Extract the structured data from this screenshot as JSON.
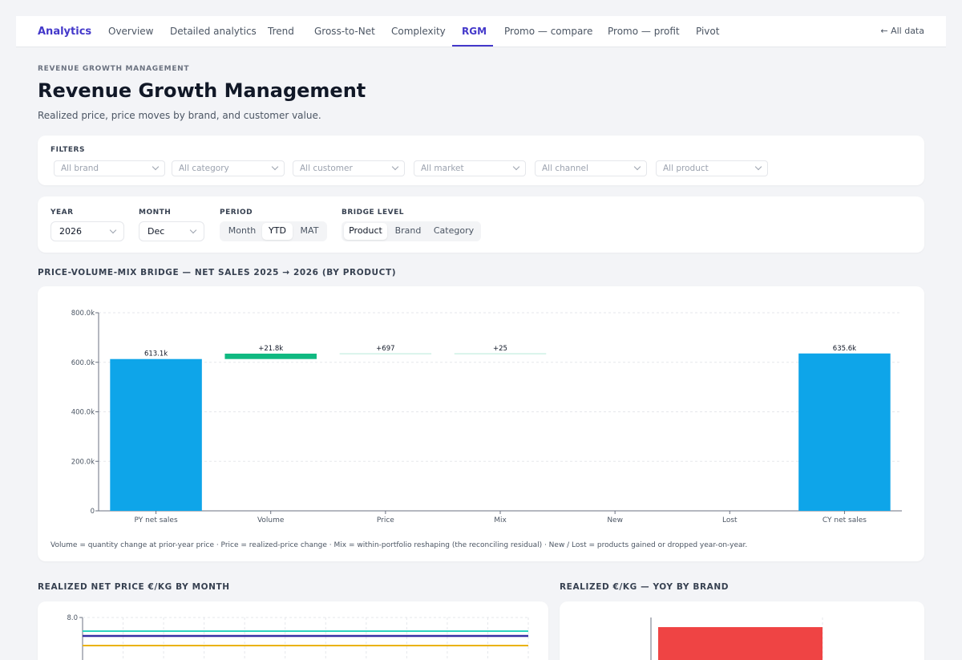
{
  "nav": {
    "brand": "Analytics",
    "items": [
      {
        "label": "Overview"
      },
      {
        "label": "Detailed analytics"
      },
      {
        "label": "Trend"
      },
      {
        "label": "Gross-to-Net"
      },
      {
        "label": "Complexity"
      },
      {
        "label": "RGM",
        "active": true
      },
      {
        "label": "Promo — compare"
      },
      {
        "label": "Promo — profit"
      },
      {
        "label": "Pivot"
      }
    ],
    "all_data": "All data"
  },
  "header": {
    "eyebrow": "REVENUE GROWTH MANAGEMENT",
    "title": "Revenue Growth Management",
    "subtitle": "Realized price, price moves by brand, and customer value."
  },
  "filters": {
    "label": "FILTERS",
    "selects": [
      "All brand",
      "All category",
      "All customer",
      "All market",
      "All channel",
      "All product"
    ]
  },
  "controls": {
    "year": {
      "label": "YEAR",
      "value": "2026"
    },
    "month": {
      "label": "MONTH",
      "value": "Dec"
    },
    "period": {
      "label": "PERIOD",
      "options": [
        "Month",
        "YTD",
        "MAT"
      ],
      "active": "YTD"
    },
    "bridge": {
      "label": "BRIDGE LEVEL",
      "options": [
        "Product",
        "Brand",
        "Category"
      ],
      "active": "Product"
    }
  },
  "sections": {
    "bridge_title": "PRICE-VOLUME-MIX BRIDGE — NET SALES 2025 → 2026 (BY PRODUCT)",
    "bridge_footnote": "Volume = quantity change at prior-year price · Price = realized-price change · Mix = within-portfolio reshaping (the reconciling residual) · New / Lost = products gained or dropped year-on-year.",
    "price_title": "REALIZED NET PRICE €/KG BY MONTH",
    "yoy_title": "REALIZED €/KG — YOY BY BRAND"
  },
  "colors": {
    "accent": "#4338ca",
    "total_bar": "#0ea5e9",
    "increase_bar": "#10b981",
    "yoy_bar": "#ef4444",
    "line_teal": "#2dd4bf",
    "line_navy": "#3730a3",
    "line_gold": "#eab308"
  },
  "chart_data": [
    {
      "type": "bar",
      "subtype": "waterfall",
      "categories": [
        "PY net sales",
        "Volume",
        "Price",
        "Mix",
        "New",
        "Lost",
        "CY net sales"
      ],
      "values": [
        613100,
        21800,
        697,
        25,
        0,
        0,
        635600
      ],
      "kinds": [
        "total",
        "delta",
        "delta",
        "delta",
        "delta",
        "delta",
        "total"
      ],
      "data_labels": [
        "613.1k",
        "+21.8k",
        "+697",
        "+25",
        "",
        "",
        "635.6k"
      ],
      "ylim": [
        0,
        800000
      ],
      "yticks": [
        "0",
        "200.0k",
        "400.0k",
        "600.0k",
        "800.0k"
      ],
      "grid": true
    },
    {
      "type": "line",
      "ytick_visible": "8.0",
      "series_count": 3,
      "grid": true
    },
    {
      "type": "bar",
      "series_count": 1
    }
  ]
}
